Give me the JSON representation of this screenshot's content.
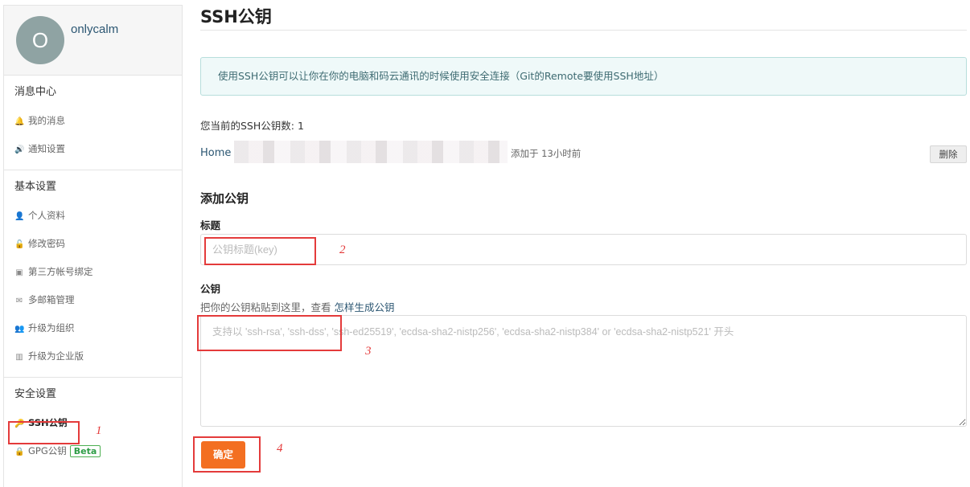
{
  "sidebar": {
    "avatar_letter": "O",
    "username": "onlycalm",
    "sections": [
      {
        "title": "消息中心",
        "items": [
          {
            "label": "我的消息",
            "icon": "bell-icon"
          },
          {
            "label": "通知设置",
            "icon": "speaker-icon"
          }
        ]
      },
      {
        "title": "基本设置",
        "items": [
          {
            "label": "个人资料",
            "icon": "user-icon"
          },
          {
            "label": "修改密码",
            "icon": "unlock-icon"
          },
          {
            "label": "第三方帐号绑定",
            "icon": "contact-card-icon"
          },
          {
            "label": "多邮箱管理",
            "icon": "envelope-icon"
          },
          {
            "label": "升级为组织",
            "icon": "users-icon"
          },
          {
            "label": "升级为企业版",
            "icon": "building-icon"
          }
        ]
      },
      {
        "title": "安全设置",
        "items": [
          {
            "label": "SSH公钥",
            "icon": "key-icon",
            "active": true
          },
          {
            "label": "GPG公钥",
            "icon": "lock-icon",
            "badge": "Beta"
          }
        ]
      }
    ]
  },
  "main": {
    "title": "SSH公钥",
    "notice": "使用SSH公钥可以让你在你的电脑和码云通讯的时候使用安全连接（Git的Remote要使用SSH地址）",
    "key_count_text": "您当前的SSH公钥数: 1",
    "keys": [
      {
        "name": "Home",
        "added": "添加于 13小时前",
        "delete_label": "删除"
      }
    ],
    "add_heading": "添加公钥",
    "title_label": "标题",
    "title_placeholder": "公钥标题(key)",
    "key_label": "公钥",
    "key_hint": "把你的公钥粘贴到这里，查看",
    "key_hint_link": "怎样生成公钥",
    "key_placeholder": "支持以 'ssh-rsa', 'ssh-dss', 'ssh-ed25519', 'ecdsa-sha2-nistp256', 'ecdsa-sha2-nistp384' or 'ecdsa-sha2-nistp521' 开头",
    "submit_label": "确定"
  },
  "annotations": {
    "n1": "1",
    "n2": "2",
    "n3": "3",
    "n4": "4"
  },
  "colors": {
    "accent": "#f36f21",
    "annotation": "#e43b3b",
    "link": "#2b5672",
    "notice_bg": "#eff9f9"
  }
}
